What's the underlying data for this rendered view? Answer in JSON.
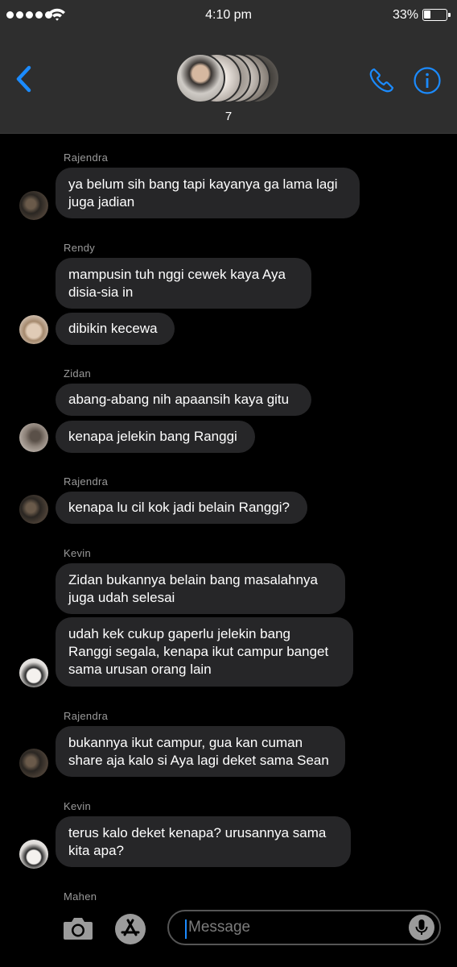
{
  "status_bar": {
    "time": "4:10 pm",
    "battery": "33%"
  },
  "header": {
    "member_count": "7"
  },
  "messages": [
    {
      "sender": "Rajendra",
      "bubbles": [
        {
          "lines": [
            "ya belum sih bang tapi kayanya ga lama lagi",
            "juga jadian"
          ]
        }
      ]
    },
    {
      "sender": "Rendy",
      "bubbles": [
        {
          "lines": [
            "mampusin tuh nggi cewek kaya Aya",
            "disia-sia in"
          ]
        },
        {
          "lines": [
            "dibikin kecewa"
          ]
        }
      ]
    },
    {
      "sender": "Zidan",
      "bubbles": [
        {
          "lines": [
            "abang-abang nih apaansih kaya gitu"
          ]
        },
        {
          "lines": [
            "kenapa jelekin bang Ranggi"
          ]
        }
      ]
    },
    {
      "sender": "Rajendra",
      "bubbles": [
        {
          "lines": [
            "kenapa lu cil kok jadi belain Ranggi?"
          ]
        }
      ]
    },
    {
      "sender": "Kevin",
      "bubbles": [
        {
          "lines": [
            "Zidan bukannya belain bang masalahnya",
            "juga udah selesai"
          ]
        },
        {
          "lines": [
            "udah kek cukup gaperlu jelekin bang",
            "Ranggi segala, kenapa ikut campur banget",
            "sama urusan orang lain"
          ]
        }
      ]
    },
    {
      "sender": "Rajendra",
      "bubbles": [
        {
          "lines": [
            "bukannya ikut campur, gua kan cuman",
            "share aja kalo si Aya lagi deket sama Sean"
          ]
        }
      ]
    },
    {
      "sender": "Kevin",
      "bubbles": [
        {
          "lines": [
            "terus kalo deket kenapa? urusannya sama",
            "kita apa?"
          ]
        }
      ]
    },
    {
      "sender": "Mahen",
      "bubbles": []
    }
  ],
  "input": {
    "placeholder": "Message"
  },
  "icons": {
    "back": "chevron-left-icon",
    "call": "phone-icon",
    "info": "info-icon",
    "camera": "camera-icon",
    "apps": "app-store-icon",
    "mic": "microphone-icon"
  },
  "colors": {
    "accent": "#1b8bff",
    "bubble": "#262628",
    "header": "#2e2e2e",
    "background": "#000000"
  }
}
